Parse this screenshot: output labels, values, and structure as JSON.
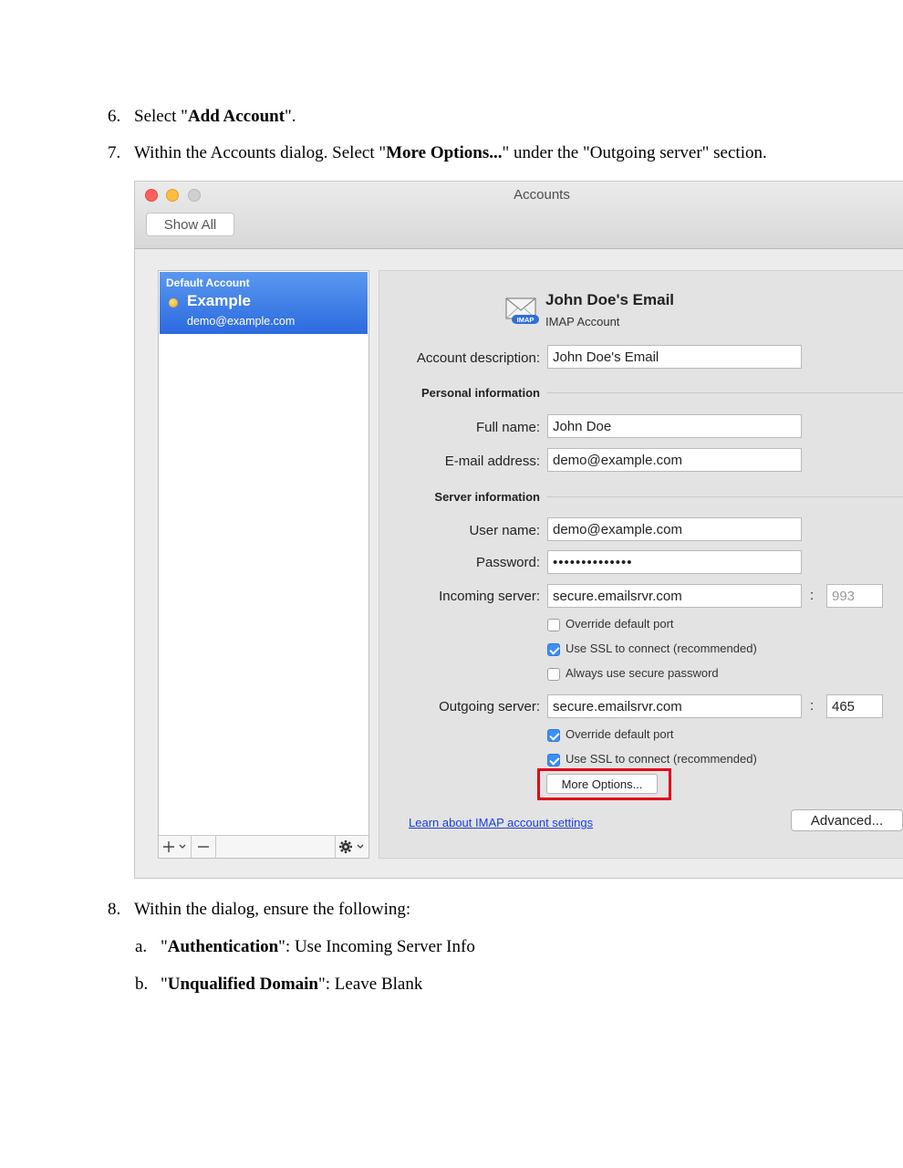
{
  "steps": {
    "step6": {
      "num": "6.",
      "pre": "Select \"",
      "bold": "Add Account",
      "post": "\"."
    },
    "step7": {
      "num": "7.",
      "pre": "Within the Accounts dialog. Select \"",
      "bold": "More Options...",
      "post": "\" under the \"Outgoing server\" section."
    },
    "step8": {
      "num": "8.",
      "text": "Within the dialog, ensure the following:"
    },
    "step8a": {
      "num": "a.",
      "pre": "\"",
      "bold": "Authentication",
      "post": "\": Use Incoming Server Info"
    },
    "step8b": {
      "num": "b.",
      "pre": "\"",
      "bold": "Unqualified Domain",
      "post": "\": Leave Blank"
    }
  },
  "window": {
    "title": "Accounts",
    "show_all": "Show All"
  },
  "sidebar": {
    "section_label": "Default Account",
    "account_name": "Example",
    "account_email": "demo@example.com",
    "add_icon": "plus-chevron-icon",
    "remove_icon": "minus-icon",
    "gear_icon": "gear-chevron-icon"
  },
  "account": {
    "name": "John Doe's Email",
    "type": "IMAP Account",
    "badge": "IMAP",
    "description_label": "Account description:",
    "description_value": "John Doe's Email",
    "personal_section": "Personal information",
    "fullname_label": "Full name:",
    "fullname_value": "John Doe",
    "email_label": "E-mail address:",
    "email_value": "demo@example.com",
    "server_section": "Server information",
    "username_label": "User name:",
    "username_value": "demo@example.com",
    "password_label": "Password:",
    "password_value": "••••••••••••••",
    "incoming_label": "Incoming server:",
    "incoming_value": "secure.emailsrvr.com",
    "incoming_port": "993",
    "override_in_label": "Override default port",
    "override_in_checked": false,
    "ssl_in_label": "Use SSL to connect (recommended)",
    "ssl_in_checked": true,
    "secure_pw_label": "Always use secure password",
    "secure_pw_checked": false,
    "outgoing_label": "Outgoing server:",
    "outgoing_value": "secure.emailsrvr.com",
    "outgoing_port": "465",
    "override_out_label": "Override default port",
    "override_out_checked": true,
    "ssl_out_label": "Use SSL to connect (recommended)",
    "ssl_out_checked": true,
    "more_options": "More Options...",
    "learn_link": "Learn about IMAP account settings",
    "advanced": "Advanced...",
    "colon": ":"
  },
  "colors": {
    "highlight": "#e3001b",
    "selection": "#2c6ae0",
    "checkbox_on": "#3b8ff5",
    "link": "#1a3ed8"
  }
}
